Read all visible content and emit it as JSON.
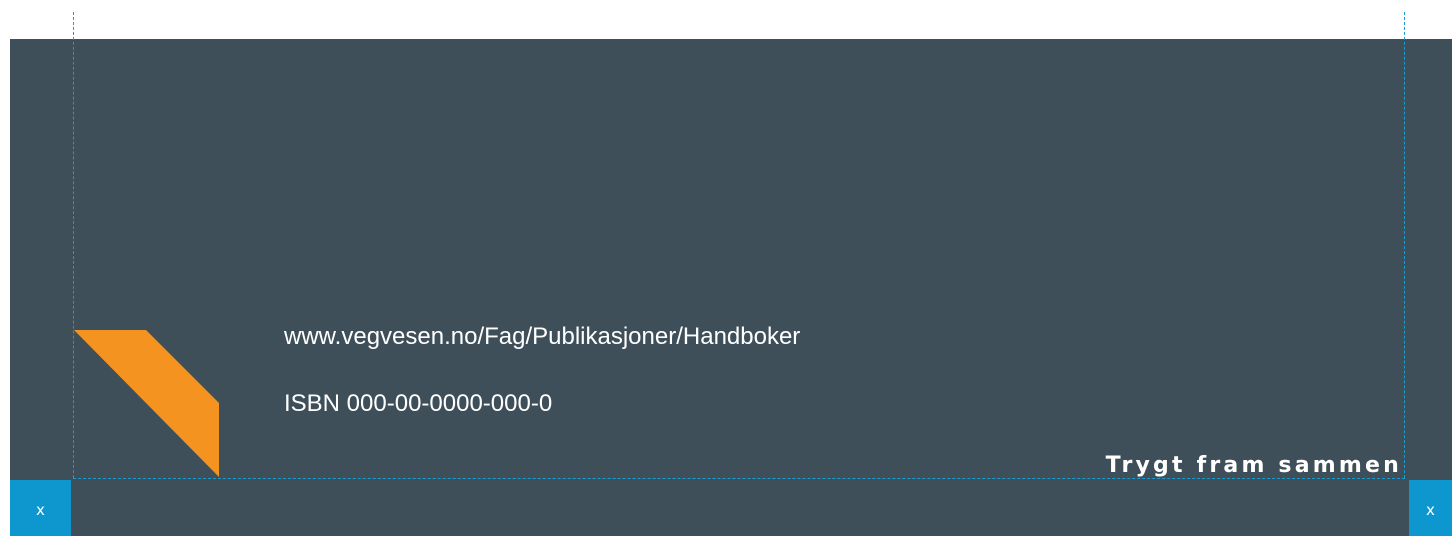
{
  "colors": {
    "background_panel": "#3e4f59",
    "accent_orange": "#f49320",
    "guide_blue": "#149ed4",
    "marker_blue": "#0e96cf",
    "text": "#ffffff"
  },
  "logo": {
    "icon": "orange-chevron-icon"
  },
  "info": {
    "url": "www.vegvesen.no/Fag/Publikasjoner/Handboker",
    "isbn": "ISBN 000-00-0000-000-0"
  },
  "slogan": "Trygt fram sammen",
  "markers": {
    "left_label": "x",
    "right_label": "x"
  }
}
